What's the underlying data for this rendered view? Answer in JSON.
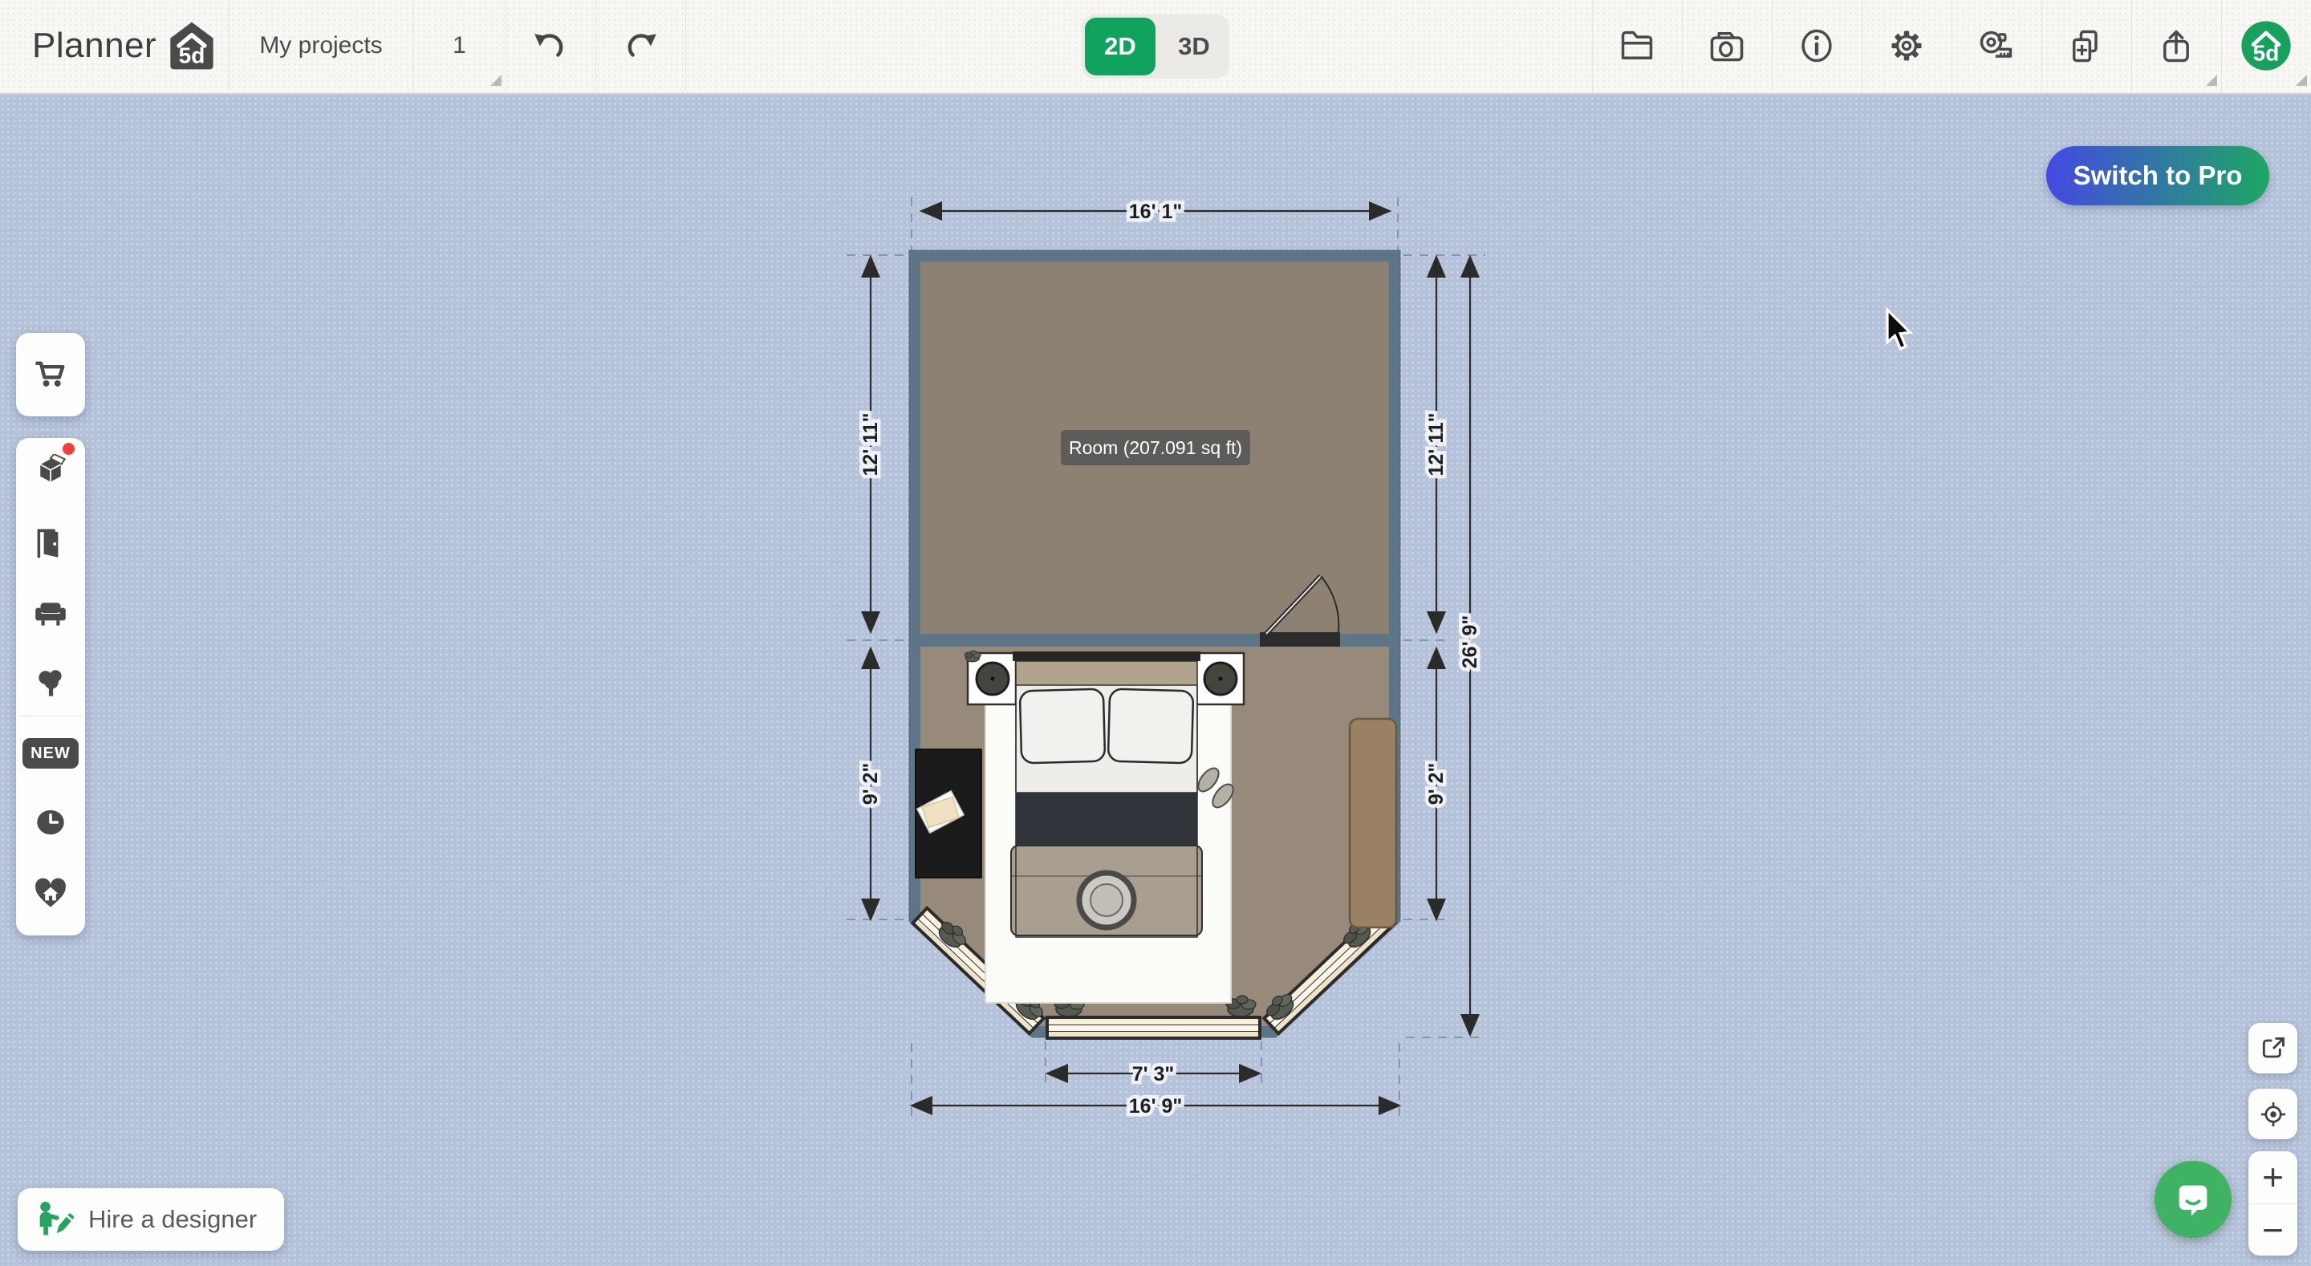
{
  "app": {
    "brand": "Planner",
    "brand_badge": "5d"
  },
  "topbar": {
    "my_projects_label": "My projects",
    "floor_number": "1",
    "view_modes": {
      "d2": "2D",
      "d3": "3D",
      "active": "2D"
    },
    "history_icons": [
      "undo-icon",
      "redo-icon"
    ],
    "right_icons": [
      "folder-icon",
      "snapshot-camera-icon",
      "info-icon",
      "settings-gear-icon",
      "tape-measure-icon",
      "duplicate-plus-icon",
      "export-share-icon",
      "account-avatar"
    ],
    "avatar_label": "5d"
  },
  "sidebar": {
    "cart_icon": "shopping-cart-icon",
    "tools": [
      "construction-cube-icon",
      "door-icon",
      "furniture-sofa-icon",
      "outdoor-tree-icon",
      "new-badge",
      "history-clock-icon",
      "favorites-heart-home-icon"
    ],
    "new_badge_label": "NEW",
    "notification_dot_color": "#f53d3d"
  },
  "plan": {
    "room_label": "Room (207.091 sq ft)",
    "dims": {
      "top": "16' 1\"",
      "left_upper": "12' 11\"",
      "left_lower": "9' 2\"",
      "right_upper": "12' 11\"",
      "right_lower": "9' 2\"",
      "right_total": "26' 9\"",
      "bottom_window": "7' 3\"",
      "bottom_total": "16' 9\""
    },
    "objects": [
      "double-bed",
      "nightstand-left",
      "nightstand-right",
      "lamp-left",
      "lamp-right",
      "rug",
      "desk",
      "bench",
      "slippers",
      "door-swing",
      "bay-window-left",
      "bay-window-center",
      "bay-window-right",
      "plants"
    ]
  },
  "buttons": {
    "switch_to_pro": "Switch to Pro",
    "hire_designer": "Hire a designer",
    "zoom_in": "+",
    "zoom_out": "−"
  },
  "colors": {
    "accent_green": "#0fa35d",
    "pro_gradient_left": "#4549e2",
    "pro_gradient_right": "#1ea765",
    "canvas": "#b5c2d9",
    "wall": "#5e7487",
    "floor_upper": "#8d8174",
    "floor_lower": "#978a7a",
    "chat_green": "#40b264"
  }
}
